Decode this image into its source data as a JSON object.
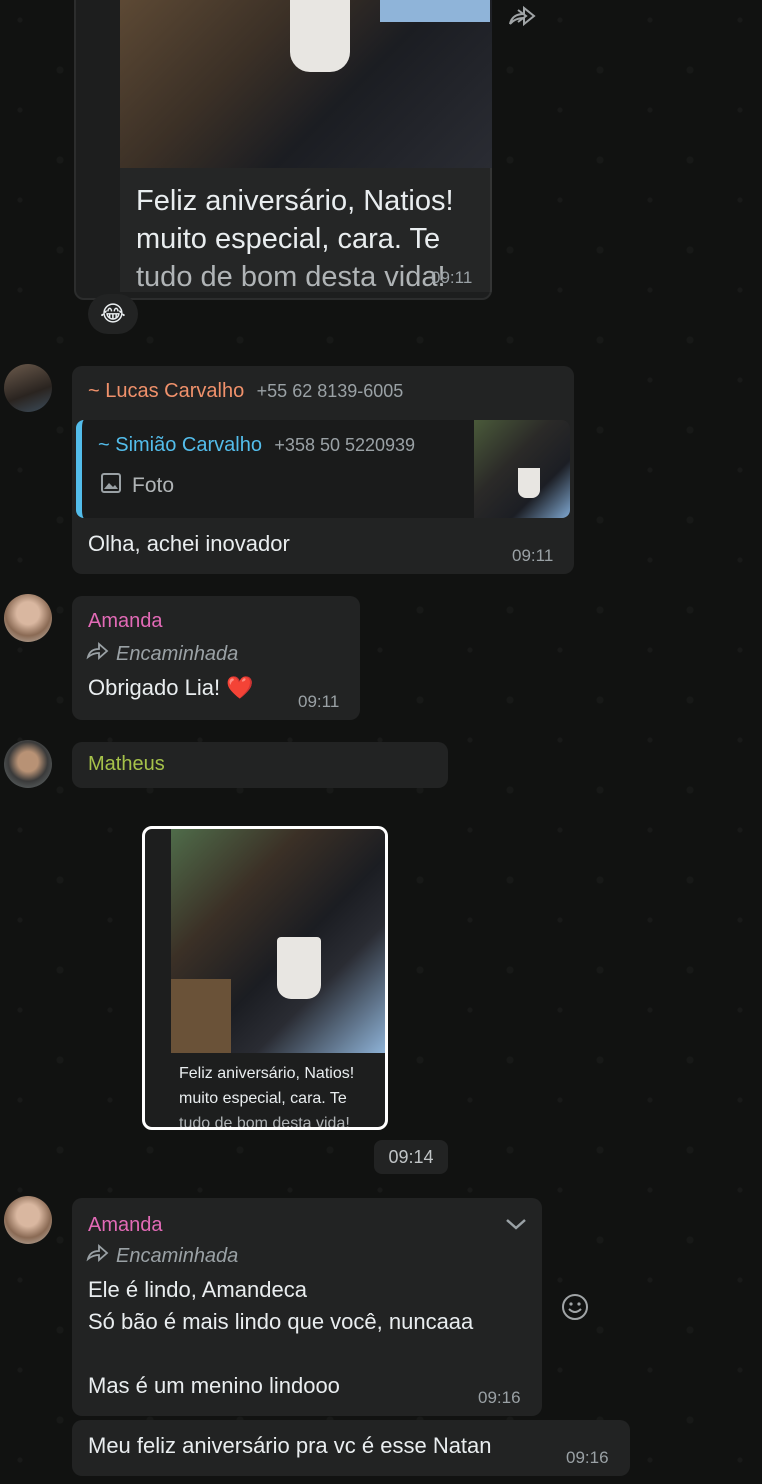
{
  "top_message": {
    "caption_lines": [
      "Feliz aniversário, Natios!",
      "muito especial, cara. Te",
      "tudo de bom desta vida!"
    ],
    "time": "09:11",
    "reaction": "😂"
  },
  "messages": [
    {
      "sender": "~ Lucas Carvalho",
      "phone": "+55 62 8139-6005",
      "sender_color": "#f0916b",
      "quote": {
        "sender": "~ Simião Carvalho",
        "phone": "+358 50 5220939",
        "type_label": "Foto",
        "sender_color": "#53bdeb"
      },
      "text": "Olha, achei inovador",
      "time": "09:11"
    },
    {
      "sender": "Amanda",
      "sender_color": "#e26ab6",
      "forwarded_label": "Encaminhada",
      "text": "Obrigado Lia! ❤️",
      "time": "09:11"
    },
    {
      "sender": "Matheus",
      "sender_color": "#a6c24a",
      "image_caption_lines": [
        "Feliz aniversário, Natios!",
        "muito especial, cara. Te",
        "tudo de bom desta vida!"
      ],
      "time": "09:14"
    },
    {
      "sender": "Amanda",
      "sender_color": "#e26ab6",
      "forwarded_label": "Encaminhada",
      "lines": [
        "Ele é lindo, Amandeca",
        "Só bão é mais lindo que você, nuncaaa",
        "",
        "Mas é um menino lindooo"
      ],
      "time": "09:16"
    },
    {
      "text": "Meu feliz aniversário pra vc é esse Natan",
      "time": "09:16"
    }
  ]
}
